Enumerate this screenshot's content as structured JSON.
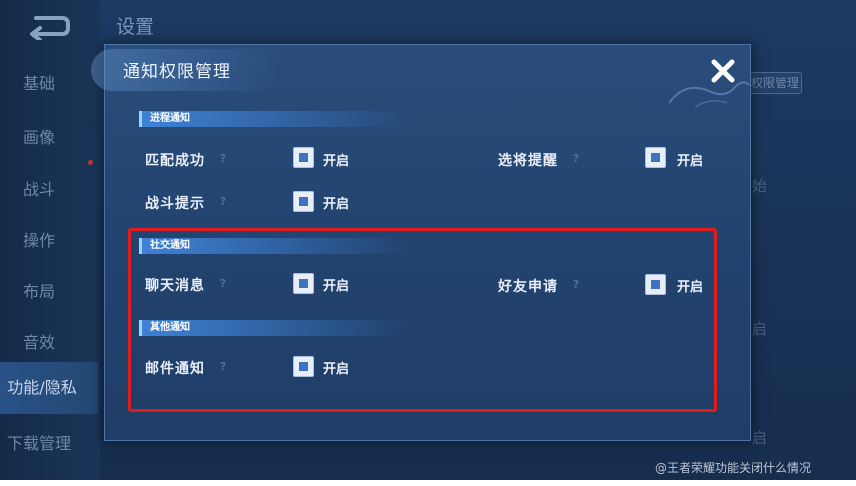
{
  "background": {
    "title": "设置",
    "menu_items": [
      "基础",
      "画像",
      "战斗",
      "操作",
      "布局",
      "音效",
      "功能/隐私",
      "下载管理"
    ],
    "right_button": "权限管理",
    "right_fragments": [
      "始",
      "启",
      "启"
    ]
  },
  "dialog": {
    "title": "通知权限管理",
    "sections": [
      {
        "header": "进程通知",
        "rows": [
          [
            {
              "label": "匹配成功",
              "state": "开启"
            },
            {
              "label": "选将提醒",
              "state": "开启"
            }
          ],
          [
            {
              "label": "战斗提示",
              "state": "开启"
            }
          ]
        ]
      },
      {
        "header": "社交通知",
        "rows": [
          [
            {
              "label": "聊天消息",
              "state": "开启"
            },
            {
              "label": "好友申请",
              "state": "开启"
            }
          ]
        ]
      },
      {
        "header": "其他通知",
        "rows": [
          [
            {
              "label": "邮件通知",
              "state": "开启"
            }
          ]
        ]
      }
    ]
  },
  "watermark": "@王者荣耀功能关闭什么情况",
  "colors": {
    "highlight": "#e01c1c",
    "checkbox_fill": "#3c74c2",
    "section_band": "#3e82d6"
  }
}
